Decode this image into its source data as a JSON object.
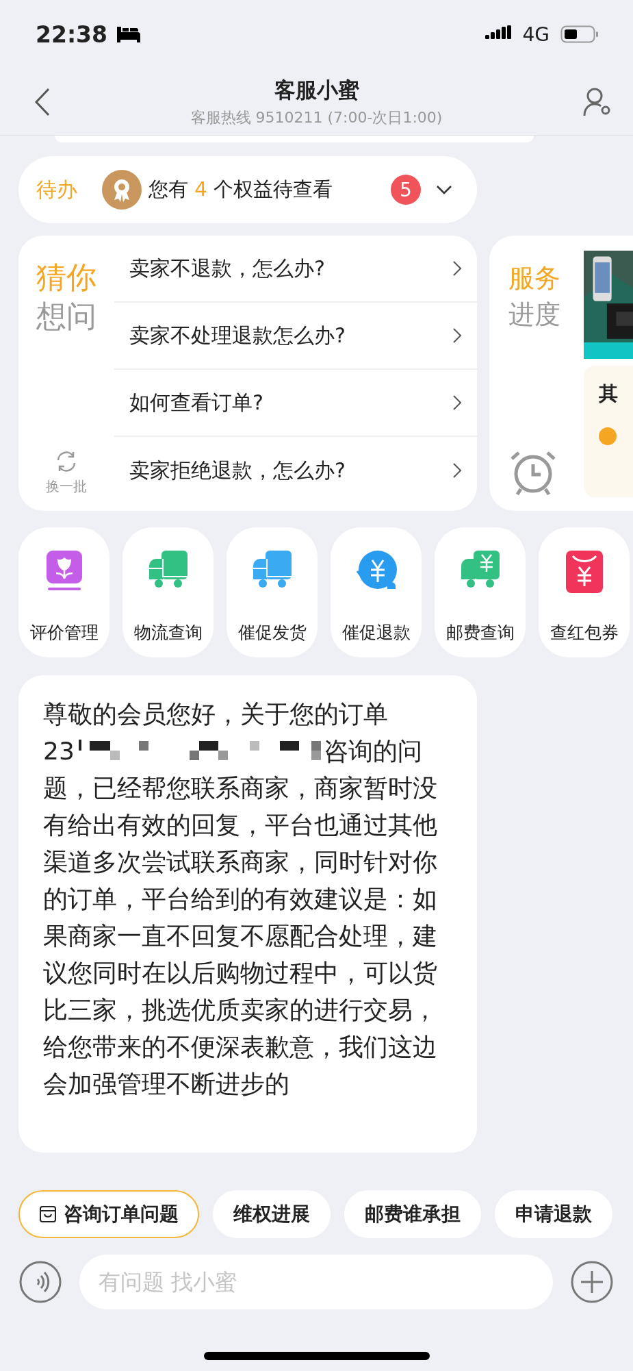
{
  "status_bar": {
    "time": "22:38",
    "network": "4G"
  },
  "nav": {
    "title": "客服小蜜",
    "subtitle": "客服热线 9510211 (7:00-次日1:00)"
  },
  "todo": {
    "label": "待办",
    "text_before": "您有 ",
    "count": "4",
    "text_after": " 个权益待查看",
    "badge": "5"
  },
  "guess": {
    "title_top": "猜你",
    "title_bottom": "想问",
    "refresh": "换一批",
    "questions": [
      "卖家不退款，怎么办?",
      "卖家不处理退款怎么办?",
      "如何查看订单?",
      "卖家拒绝退款，怎么办?"
    ]
  },
  "service": {
    "title_top": "服务",
    "title_bottom": "进度",
    "card_title": "其"
  },
  "shortcuts": [
    {
      "label": "评价管理"
    },
    {
      "label": "物流查询"
    },
    {
      "label": "催促发货"
    },
    {
      "label": "催促退款"
    },
    {
      "label": "邮费查询"
    },
    {
      "label": "查红包券"
    }
  ],
  "message": {
    "line_1": "尊敬的会员您好，关于您的订单",
    "order_prefix": "23",
    "line_2_end": "咨询的问",
    "rest": "题，已经帮您联系商家，商家暂时没有给出有效的回复，平台也通过其他渠道多次尝试联系商家，同时针对你的订单，平台给到的有效建议是：如果商家一直不回复不愿配合处理，建议您同时在以后购物过程中，可以货比三家，挑选优质卖家的进行交易，给您带来的不便深表歉意，我们这边会加强管理不断进步的"
  },
  "quick_replies": [
    {
      "label": "咨询订单问题",
      "selected": true
    },
    {
      "label": "维权进展",
      "selected": false
    },
    {
      "label": "邮费谁承担",
      "selected": false
    },
    {
      "label": "申请退款",
      "selected": false
    }
  ],
  "input": {
    "placeholder": "有问题 找小蜜"
  }
}
